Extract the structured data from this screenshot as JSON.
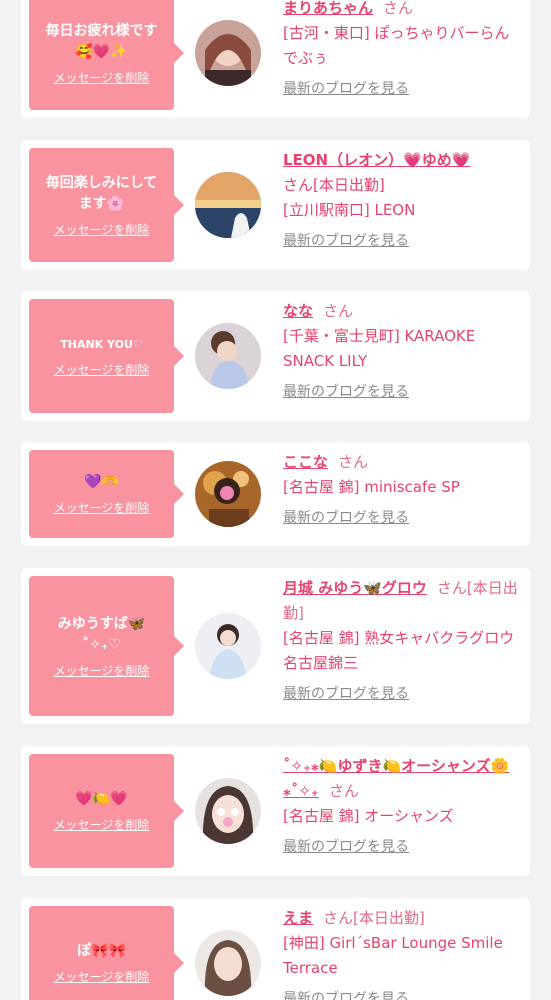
{
  "delete_label": "メッセージを削除",
  "blog_label": "最新のブログを見る",
  "colors": {
    "accent": "#e8436e",
    "message_bg": "#f8939f",
    "link_gray": "#8a8a8a"
  },
  "cards": [
    {
      "message": "毎日お疲れ様です\n🥰💗✨",
      "name": "まりあちゃん",
      "suffix": "さん",
      "shop": "[古河・東口] ぽっちゃりバーらんでぶぅ"
    },
    {
      "message": "毎回楽しみにしてます🌸",
      "name": "LEON（レオン）💗ゆめ💗",
      "suffix": "さん[本日出勤]",
      "shop": "[立川駅南口] LEON"
    },
    {
      "message": "THANK YOU♡",
      "name": "なな",
      "suffix": "さん",
      "shop": "[千葉・富士見町] KARAOKE SNACK LILY"
    },
    {
      "message": "💜🫶",
      "name": "ここな",
      "suffix": "さん",
      "shop": "[名古屋 錦] miniscafe SP"
    },
    {
      "message": "みゆうすば🦋\n˚✧₊♡",
      "name": "月城 みゆう🦋グロウ",
      "suffix": "さん[本日出勤]",
      "shop": "[名古屋 錦] 熟女キャバクラグロウ 名古屋錦三"
    },
    {
      "message": "💗🍋💗",
      "name": "˚✧₊⁎🍋ゆずき🍋オーシャンズ🌼⁎˚✧₊",
      "suffix": "さん",
      "shop": "[名古屋 錦] オーシャンズ"
    },
    {
      "message": "ぽ🎀🎀",
      "name": "えま",
      "suffix": "さん[本日出勤]",
      "shop": "[神田] Girl´sBar Lounge Smile Terrace"
    }
  ]
}
